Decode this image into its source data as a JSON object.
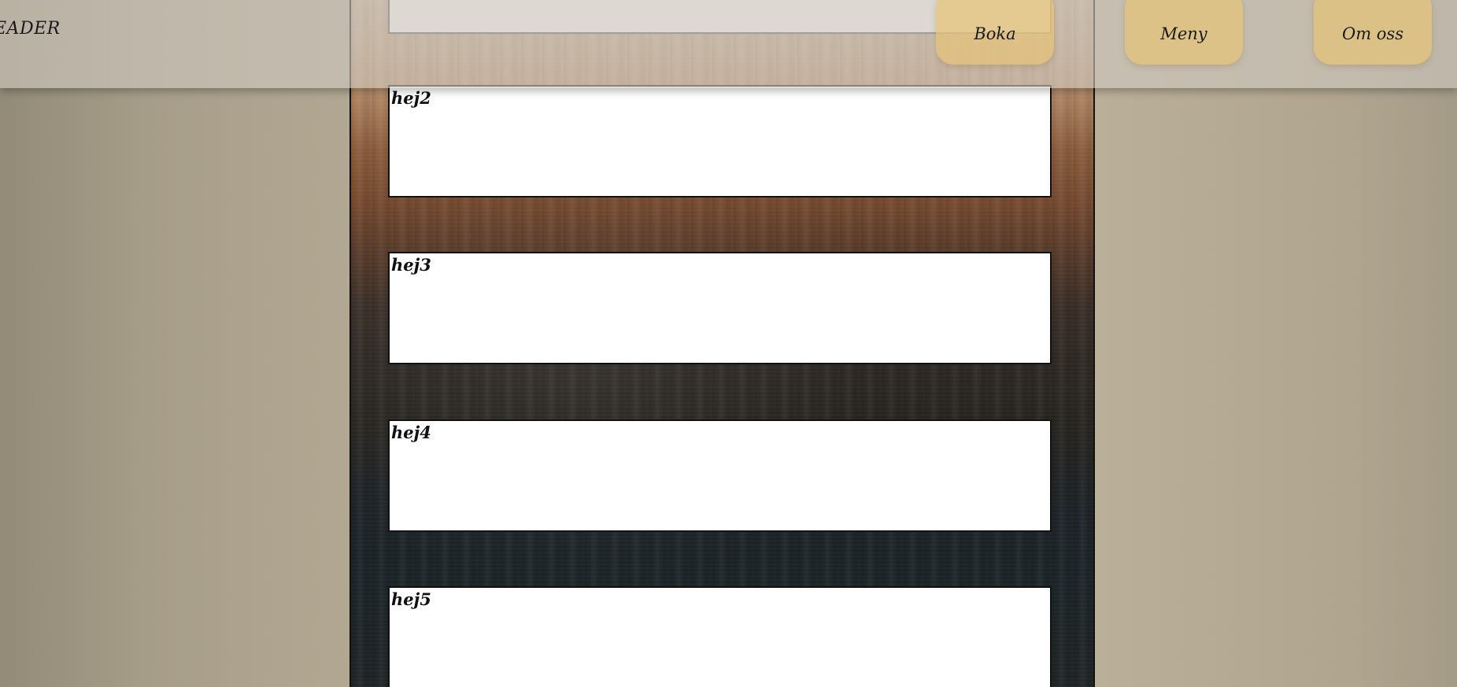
{
  "header": {
    "logo_text": "EADER",
    "nav": [
      {
        "label": "Boka"
      },
      {
        "label": "Meny"
      },
      {
        "label": "Om oss"
      }
    ]
  },
  "main": {
    "cards": [
      {
        "title": ""
      },
      {
        "title": "hej2"
      },
      {
        "title": "hej3"
      },
      {
        "title": "hej4"
      },
      {
        "title": "hej5"
      }
    ]
  }
}
